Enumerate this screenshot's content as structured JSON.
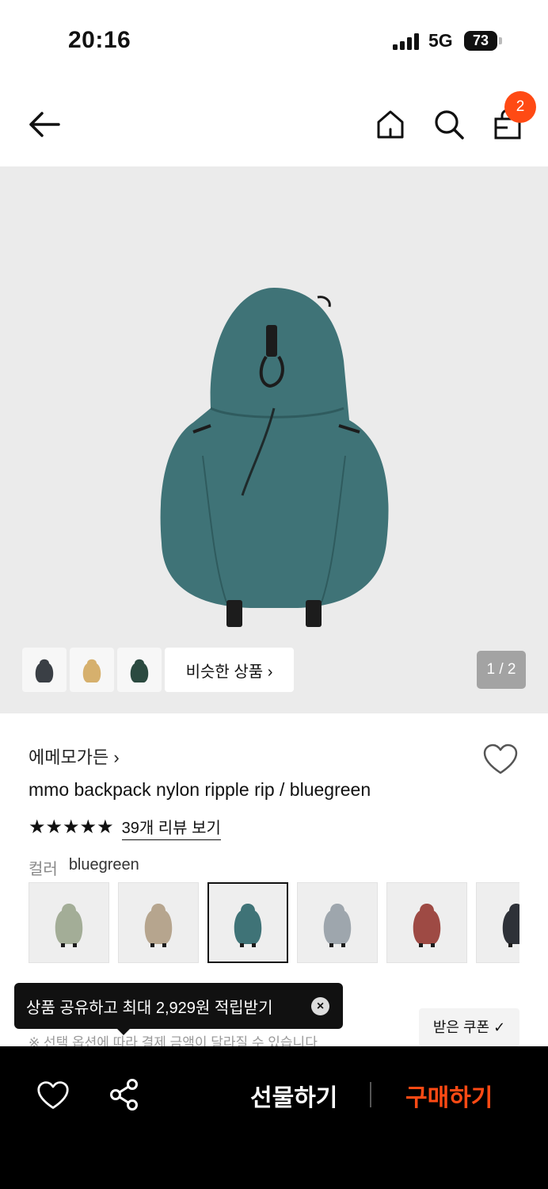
{
  "status_bar": {
    "time": "20:16",
    "network": "5G",
    "battery": "73"
  },
  "header": {
    "cart_count": "2"
  },
  "gallery": {
    "similar_label": "비슷한 상품 ›",
    "pager": "1 / 2"
  },
  "product": {
    "brand": "에메모가든 ›",
    "title": "mmo backpack nylon ripple rip / bluegreen",
    "stars": "★★★★★",
    "reviews_link": "39개 리뷰 보기",
    "color_label": "컬러",
    "color_value": "bluegreen"
  },
  "swatches": [
    {
      "color": "#a3ad97",
      "selected": false
    },
    {
      "color": "#b6a58e",
      "selected": false
    },
    {
      "color": "#3f7377",
      "selected": true
    },
    {
      "color": "#9ea6ad",
      "selected": false
    },
    {
      "color": "#9e4a44",
      "selected": false
    },
    {
      "color": "#2e3138",
      "selected": false
    }
  ],
  "toast": {
    "text": "상품 공유하고 최대 2,929원 적립받기",
    "close": "×"
  },
  "coupon": {
    "label": "받은 쿠폰 ✓"
  },
  "notice": "※ 선택 옵션에 따라 결제 금액이 달라질 수 있습니다",
  "bottom_bar": {
    "gift_label": "선물하기",
    "buy_label": "구매하기"
  },
  "colors": {
    "accent": "#ff4a14",
    "product": "#3f7377"
  }
}
